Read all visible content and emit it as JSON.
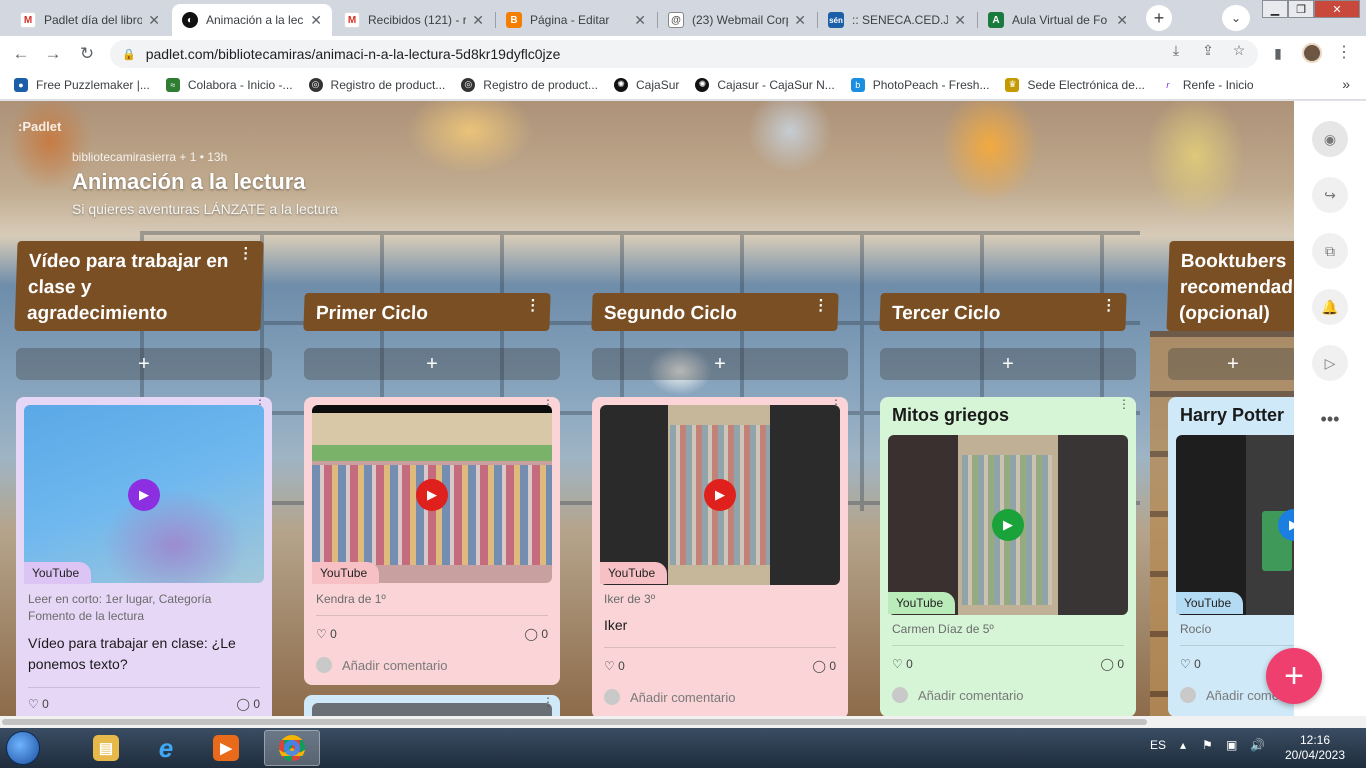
{
  "browser": {
    "tabs": [
      {
        "title": "Padlet día del libro",
        "favicon": "gmail-icon",
        "color": "#d93025",
        "active": false
      },
      {
        "title": "Animación a la lec",
        "favicon": "padlet-icon",
        "color": "#111111",
        "active": true
      },
      {
        "title": "Recibidos (121) - r",
        "favicon": "gmail-icon",
        "color": "#d93025",
        "active": false
      },
      {
        "title": "Página - Editar",
        "favicon": "blogger-icon",
        "color": "#f57d00",
        "active": false
      },
      {
        "title": "(23) Webmail Corp",
        "favicon": "webmail-icon",
        "color": "#555555",
        "active": false
      },
      {
        "title": ":: SENECA.CED.JUN",
        "favicon": "seneca-icon",
        "color": "#1a5fa8",
        "active": false
      },
      {
        "title": "Aula Virtual de Fo",
        "favicon": "aula-icon",
        "color": "#1b7a3e",
        "active": false
      }
    ],
    "url": "padlet.com/bibliotecamiras/animaci-n-a-la-lectura-5d8kr19dyflc0jze",
    "bookmarks": [
      {
        "label": "Free Puzzlemaker |...",
        "icon": "puzzle-icon",
        "color": "#1c5fa8"
      },
      {
        "label": "Colabora - Inicio -...",
        "icon": "colabora-icon",
        "color": "#2e7d32"
      },
      {
        "label": "Registro de product...",
        "icon": "globe-icon",
        "color": "#333333"
      },
      {
        "label": "Registro de product...",
        "icon": "globe-icon",
        "color": "#333333"
      },
      {
        "label": "CajaSur",
        "icon": "cajasur-icon",
        "color": "#111111"
      },
      {
        "label": "Cajasur - CajaSur N...",
        "icon": "cajasur-icon",
        "color": "#111111"
      },
      {
        "label": "PhotoPeach - Fresh...",
        "icon": "photopeach-icon",
        "color": "#1a8fe0"
      },
      {
        "label": "Sede Electrónica de...",
        "icon": "sede-icon",
        "color": "#c49a00"
      },
      {
        "label": "Renfe - Inicio",
        "icon": "renfe-icon",
        "color": "#8a2be2"
      }
    ]
  },
  "padlet": {
    "logo": ":Padlet",
    "meta": "bibliotecamirasierra + 1 • 13h",
    "title": "Animación a la lectura",
    "subtitle": "Si quieres aventuras LÁNZATE a la lectura",
    "columns": [
      {
        "title": "Vídeo para trabajar en clase y agradecimiento"
      },
      {
        "title": "Primer Ciclo"
      },
      {
        "title": "Segundo Ciclo"
      },
      {
        "title": "Tercer Ciclo"
      },
      {
        "title": "Booktubers recomendad (opcional)"
      }
    ],
    "cards": [
      {
        "badge": "YouTube",
        "caption": "Leer en corto: 1er lugar, Categoría Fomento de la lectura",
        "body": "Vídeo para trabajar en clase: ¿Le ponemos texto?",
        "likes": "0",
        "comments": "0",
        "play_color": "#8b2fe0",
        "bg": "#e7d7f7",
        "badge_bg": "#dcc4f5"
      },
      {
        "badge": "YouTube",
        "caption": "Kendra de 1º",
        "likes": "0",
        "comments": "0",
        "comment_placeholder": "Añadir comentario",
        "play_color": "#e0201c",
        "bg": "#fad4d6",
        "badge_bg": "#f7c0c4"
      },
      {
        "badge": "YouTube",
        "caption": "Iker de 3º",
        "body": "Iker",
        "likes": "0",
        "comments": "0",
        "comment_placeholder": "Añadir comentario",
        "play_color": "#e0201c",
        "bg": "#fad4d6",
        "badge_bg": "#f7c0c4"
      },
      {
        "title": "Mitos griegos",
        "badge": "YouTube",
        "caption": "Carmen Díaz de 5º",
        "likes": "0",
        "comments": "0",
        "comment_placeholder": "Añadir comentario",
        "play_color": "#1aa33a",
        "bg": "#d6f5d6",
        "badge_bg": "#b9ecb9"
      },
      {
        "title": "Harry Potter",
        "badge": "YouTube",
        "caption": "Rocío",
        "likes": "0",
        "comment_placeholder": "Añadir come",
        "play_color": "#1a7fe0",
        "bg": "#cfe9f8",
        "badge_bg": "#b3dcf4"
      }
    ]
  },
  "taskbar": {
    "language": "ES",
    "time": "12:16",
    "date": "20/04/2023"
  }
}
